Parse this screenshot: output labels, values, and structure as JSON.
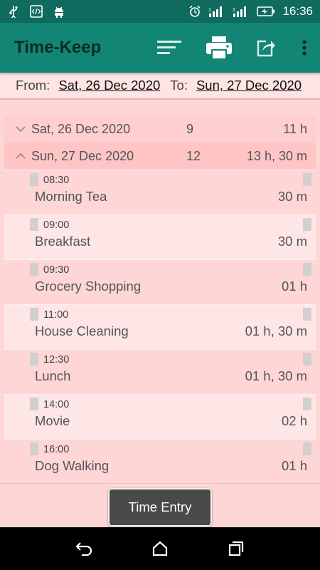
{
  "status_bar": {
    "time": "16:36",
    "left_icons": [
      "usb-icon",
      "developer-mode-icon",
      "android-debug-icon"
    ],
    "right_icons": [
      "alarm-icon",
      "signal-icon-1",
      "signal-icon-2",
      "battery-charging-icon"
    ]
  },
  "app_bar": {
    "title": "Time-Keep",
    "actions": [
      "sort-icon",
      "print-icon",
      "share-icon",
      "more-icon"
    ]
  },
  "date_range": {
    "from_label": "From:",
    "from_value": "Sat, 26 Dec 2020",
    "to_label": "To:",
    "to_value": "Sun, 27 Dec 2020"
  },
  "groups": [
    {
      "date": "Sat, 26 Dec 2020",
      "count": "9",
      "total": "11 h",
      "expanded": false
    },
    {
      "date": "Sun, 27 Dec 2020",
      "count": "12",
      "total": "13 h, 30 m",
      "expanded": true
    }
  ],
  "entries": [
    {
      "time": "08:30",
      "name": "Morning Tea",
      "duration": "30 m"
    },
    {
      "time": "09:00",
      "name": "Breakfast",
      "duration": "30 m"
    },
    {
      "time": "09:30",
      "name": "Grocery Shopping",
      "duration": "01 h"
    },
    {
      "time": "11:00",
      "name": "House Cleaning",
      "duration": "01 h, 30 m"
    },
    {
      "time": "12:30",
      "name": "Lunch",
      "duration": "01 h, 30 m"
    },
    {
      "time": "14:00",
      "name": "Movie",
      "duration": "02 h"
    },
    {
      "time": "16:00",
      "name": "Dog Walking",
      "duration": "01 h"
    }
  ],
  "bottom": {
    "time_entry_label": "Time Entry"
  },
  "colors": {
    "status_bar": "#0e6b5e",
    "app_bar": "#138574",
    "background": "#ffd6d6",
    "button": "#4a4a4a"
  },
  "nav_bar": [
    "back-icon",
    "home-icon",
    "recents-icon"
  ]
}
